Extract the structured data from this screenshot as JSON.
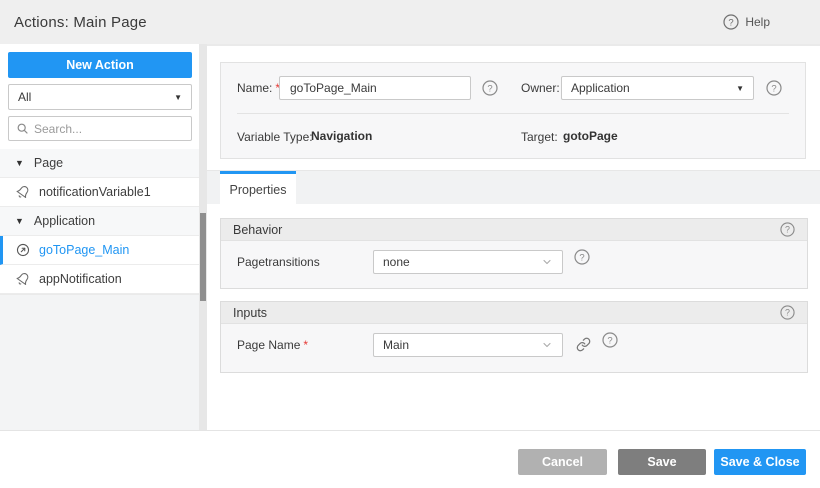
{
  "colors": {
    "accent": "#2196f3",
    "header_bg": "#efefef",
    "cancel_button": "#b1b1b1",
    "save_button": "#7e7e7e",
    "required_red": "#e53935"
  },
  "icons": {
    "help": "question-mark-circle",
    "search": "magnifier",
    "caret_collapse": "▾",
    "select_arrow": "▼",
    "combo_chevron": "chevron-down",
    "link": "chain-link",
    "notification": "bell",
    "navigation": "circle-arrow"
  },
  "header": {
    "title": "Actions: Main Page",
    "help_label": "Help"
  },
  "sidebar": {
    "new_action_label": "New Action",
    "filter_value": "All",
    "search_placeholder": "Search...",
    "tree": [
      {
        "kind": "group",
        "label": "Page"
      },
      {
        "kind": "item",
        "icon": "bell",
        "label": "notificationVariable1",
        "selected": false
      },
      {
        "kind": "group",
        "label": "Application"
      },
      {
        "kind": "item",
        "icon": "navigate",
        "label": "goToPage_Main",
        "selected": true
      },
      {
        "kind": "item",
        "icon": "bell",
        "label": "appNotification",
        "selected": false
      }
    ]
  },
  "form": {
    "name_label": "Name:",
    "required_marker": "*",
    "name_value": "goToPage_Main",
    "owner_label": "Owner:",
    "owner_value": "Application",
    "variable_type_label": "Variable Type:",
    "variable_type_value": "Navigation",
    "target_label": "Target:",
    "target_value": "gotoPage"
  },
  "tabs": [
    {
      "label": "Properties",
      "active": true
    }
  ],
  "sections": {
    "behavior": {
      "title": "Behavior",
      "field_label": "Pagetransitions",
      "field_value": "none"
    },
    "inputs": {
      "title": "Inputs",
      "field_label": "Page Name",
      "field_value": "Main"
    }
  },
  "footer": {
    "cancel_label": "Cancel",
    "save_label": "Save",
    "save_close_label": "Save & Close"
  }
}
